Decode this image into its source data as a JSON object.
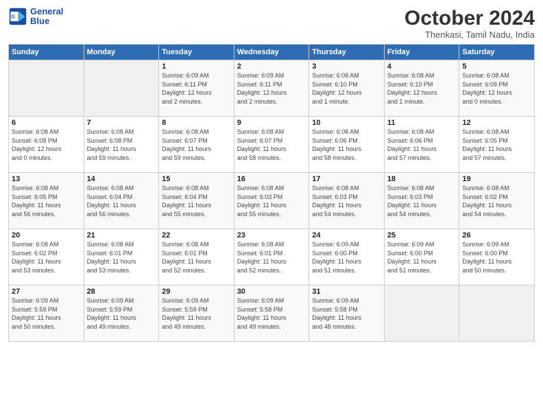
{
  "logo": {
    "line1": "General",
    "line2": "Blue"
  },
  "title": "October 2024",
  "subtitle": "Thenkasi, Tamil Nadu, India",
  "days_header": [
    "Sunday",
    "Monday",
    "Tuesday",
    "Wednesday",
    "Thursday",
    "Friday",
    "Saturday"
  ],
  "weeks": [
    [
      {
        "day": "",
        "info": ""
      },
      {
        "day": "",
        "info": ""
      },
      {
        "day": "1",
        "info": "Sunrise: 6:09 AM\nSunset: 6:11 PM\nDaylight: 12 hours\nand 2 minutes."
      },
      {
        "day": "2",
        "info": "Sunrise: 6:09 AM\nSunset: 6:11 PM\nDaylight: 12 hours\nand 2 minutes."
      },
      {
        "day": "3",
        "info": "Sunrise: 6:08 AM\nSunset: 6:10 PM\nDaylight: 12 hours\nand 1 minute."
      },
      {
        "day": "4",
        "info": "Sunrise: 6:08 AM\nSunset: 6:10 PM\nDaylight: 12 hours\nand 1 minute."
      },
      {
        "day": "5",
        "info": "Sunrise: 6:08 AM\nSunset: 6:09 PM\nDaylight: 12 hours\nand 0 minutes."
      }
    ],
    [
      {
        "day": "6",
        "info": "Sunrise: 6:08 AM\nSunset: 6:08 PM\nDaylight: 12 hours\nand 0 minutes."
      },
      {
        "day": "7",
        "info": "Sunrise: 6:08 AM\nSunset: 6:08 PM\nDaylight: 11 hours\nand 59 minutes."
      },
      {
        "day": "8",
        "info": "Sunrise: 6:08 AM\nSunset: 6:07 PM\nDaylight: 11 hours\nand 59 minutes."
      },
      {
        "day": "9",
        "info": "Sunrise: 6:08 AM\nSunset: 6:07 PM\nDaylight: 11 hours\nand 58 minutes."
      },
      {
        "day": "10",
        "info": "Sunrise: 6:08 AM\nSunset: 6:06 PM\nDaylight: 11 hours\nand 58 minutes."
      },
      {
        "day": "11",
        "info": "Sunrise: 6:08 AM\nSunset: 6:06 PM\nDaylight: 11 hours\nand 57 minutes."
      },
      {
        "day": "12",
        "info": "Sunrise: 6:08 AM\nSunset: 6:05 PM\nDaylight: 11 hours\nand 57 minutes."
      }
    ],
    [
      {
        "day": "13",
        "info": "Sunrise: 6:08 AM\nSunset: 6:05 PM\nDaylight: 11 hours\nand 56 minutes."
      },
      {
        "day": "14",
        "info": "Sunrise: 6:08 AM\nSunset: 6:04 PM\nDaylight: 11 hours\nand 56 minutes."
      },
      {
        "day": "15",
        "info": "Sunrise: 6:08 AM\nSunset: 6:04 PM\nDaylight: 11 hours\nand 55 minutes."
      },
      {
        "day": "16",
        "info": "Sunrise: 6:08 AM\nSunset: 6:03 PM\nDaylight: 11 hours\nand 55 minutes."
      },
      {
        "day": "17",
        "info": "Sunrise: 6:08 AM\nSunset: 6:03 PM\nDaylight: 11 hours\nand 54 minutes."
      },
      {
        "day": "18",
        "info": "Sunrise: 6:08 AM\nSunset: 6:03 PM\nDaylight: 11 hours\nand 54 minutes."
      },
      {
        "day": "19",
        "info": "Sunrise: 6:08 AM\nSunset: 6:02 PM\nDaylight: 11 hours\nand 54 minutes."
      }
    ],
    [
      {
        "day": "20",
        "info": "Sunrise: 6:08 AM\nSunset: 6:02 PM\nDaylight: 11 hours\nand 53 minutes."
      },
      {
        "day": "21",
        "info": "Sunrise: 6:08 AM\nSunset: 6:01 PM\nDaylight: 11 hours\nand 53 minutes."
      },
      {
        "day": "22",
        "info": "Sunrise: 6:08 AM\nSunset: 6:01 PM\nDaylight: 11 hours\nand 52 minutes."
      },
      {
        "day": "23",
        "info": "Sunrise: 6:08 AM\nSunset: 6:01 PM\nDaylight: 11 hours\nand 52 minutes."
      },
      {
        "day": "24",
        "info": "Sunrise: 6:09 AM\nSunset: 6:00 PM\nDaylight: 11 hours\nand 51 minutes."
      },
      {
        "day": "25",
        "info": "Sunrise: 6:09 AM\nSunset: 6:00 PM\nDaylight: 11 hours\nand 51 minutes."
      },
      {
        "day": "26",
        "info": "Sunrise: 6:09 AM\nSunset: 6:00 PM\nDaylight: 11 hours\nand 50 minutes."
      }
    ],
    [
      {
        "day": "27",
        "info": "Sunrise: 6:09 AM\nSunset: 5:59 PM\nDaylight: 11 hours\nand 50 minutes."
      },
      {
        "day": "28",
        "info": "Sunrise: 6:09 AM\nSunset: 5:59 PM\nDaylight: 11 hours\nand 49 minutes."
      },
      {
        "day": "29",
        "info": "Sunrise: 6:09 AM\nSunset: 5:59 PM\nDaylight: 11 hours\nand 49 minutes."
      },
      {
        "day": "30",
        "info": "Sunrise: 6:09 AM\nSunset: 5:58 PM\nDaylight: 11 hours\nand 49 minutes."
      },
      {
        "day": "31",
        "info": "Sunrise: 6:09 AM\nSunset: 5:58 PM\nDaylight: 11 hours\nand 48 minutes."
      },
      {
        "day": "",
        "info": ""
      },
      {
        "day": "",
        "info": ""
      }
    ]
  ]
}
